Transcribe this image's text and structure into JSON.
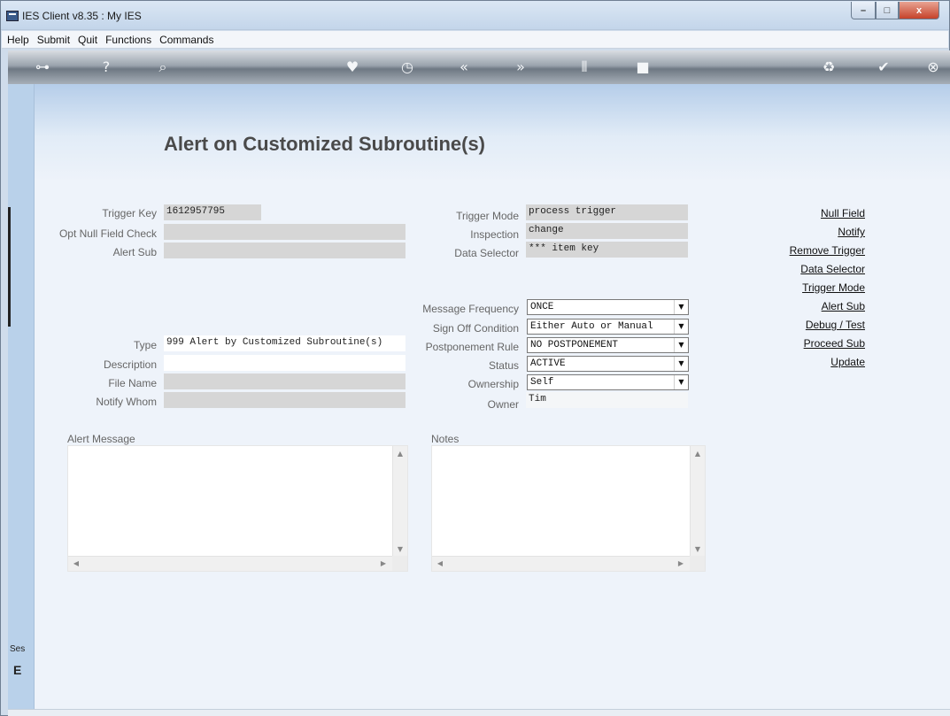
{
  "window": {
    "title": "IES Client v8.35 : My IES",
    "min_glyph": "–",
    "max_glyph": "□",
    "close_glyph": "x"
  },
  "menu": [
    "Help",
    "Submit",
    "Quit",
    "Functions",
    "Commands"
  ],
  "toolbar_icons": [
    {
      "name": "key-icon",
      "glyph": "⊶"
    },
    {
      "name": "help-icon",
      "glyph": "?"
    },
    {
      "name": "search-icon",
      "glyph": "⌕"
    },
    {
      "name": "heart-icon",
      "glyph": "♥"
    },
    {
      "name": "clock-icon",
      "glyph": "◷"
    },
    {
      "name": "rewind-icon",
      "glyph": "«"
    },
    {
      "name": "forward-icon",
      "glyph": "»"
    },
    {
      "name": "columns-icon",
      "glyph": "⫴"
    },
    {
      "name": "stop-icon",
      "glyph": "■"
    },
    {
      "name": "recycle-icon",
      "glyph": "♻"
    },
    {
      "name": "check-icon",
      "glyph": "✔"
    },
    {
      "name": "close-icon",
      "glyph": "⊗"
    }
  ],
  "page_title": "Alert on Customized Subroutine(s)",
  "left_fields": {
    "trigger_key_label": "Trigger Key",
    "trigger_key_value": "1612957795",
    "opt_null_label": "Opt Null Field Check",
    "opt_null_value": "",
    "alert_sub_label": "Alert Sub",
    "alert_sub_value": ""
  },
  "right_fields": {
    "trigger_mode_label": "Trigger Mode",
    "trigger_mode_value": "process trigger",
    "inspection_label": "Inspection",
    "inspection_value": "change",
    "data_selector_label": "Data Selector",
    "data_selector_value": "*** item key"
  },
  "type_fields": {
    "type_label": "Type",
    "type_value": "999 Alert by Customized Subroutine(s)",
    "description_label": "Description",
    "description_value": "",
    "file_name_label": "File Name",
    "file_name_value": "",
    "notify_whom_label": "Notify Whom",
    "notify_whom_value": ""
  },
  "dropdowns": {
    "message_frequency_label": "Message Frequency",
    "message_frequency_value": "ONCE",
    "sign_off_label": "Sign Off Condition",
    "sign_off_value": "Either Auto or Manual",
    "postponement_label": "Postponement Rule",
    "postponement_value": "NO POSTPONEMENT",
    "status_label": "Status",
    "status_value": "ACTIVE",
    "ownership_label": "Ownership",
    "ownership_value": "Self",
    "owner_label": "Owner",
    "owner_value": "Tim",
    "arrow_glyph": "▼"
  },
  "links": [
    "Null Field",
    "Notify",
    "Remove Trigger",
    "Data Selector",
    "Trigger Mode",
    "Alert Sub",
    "Debug / Test",
    "Proceed Sub",
    "Update"
  ],
  "alert_message_label": "Alert Message",
  "notes_label": "Notes",
  "scroll_glyphs": {
    "up": "▲",
    "down": "▼",
    "left": "◀",
    "right": "▶"
  },
  "session": {
    "label": "Ses",
    "glyph": "E"
  }
}
